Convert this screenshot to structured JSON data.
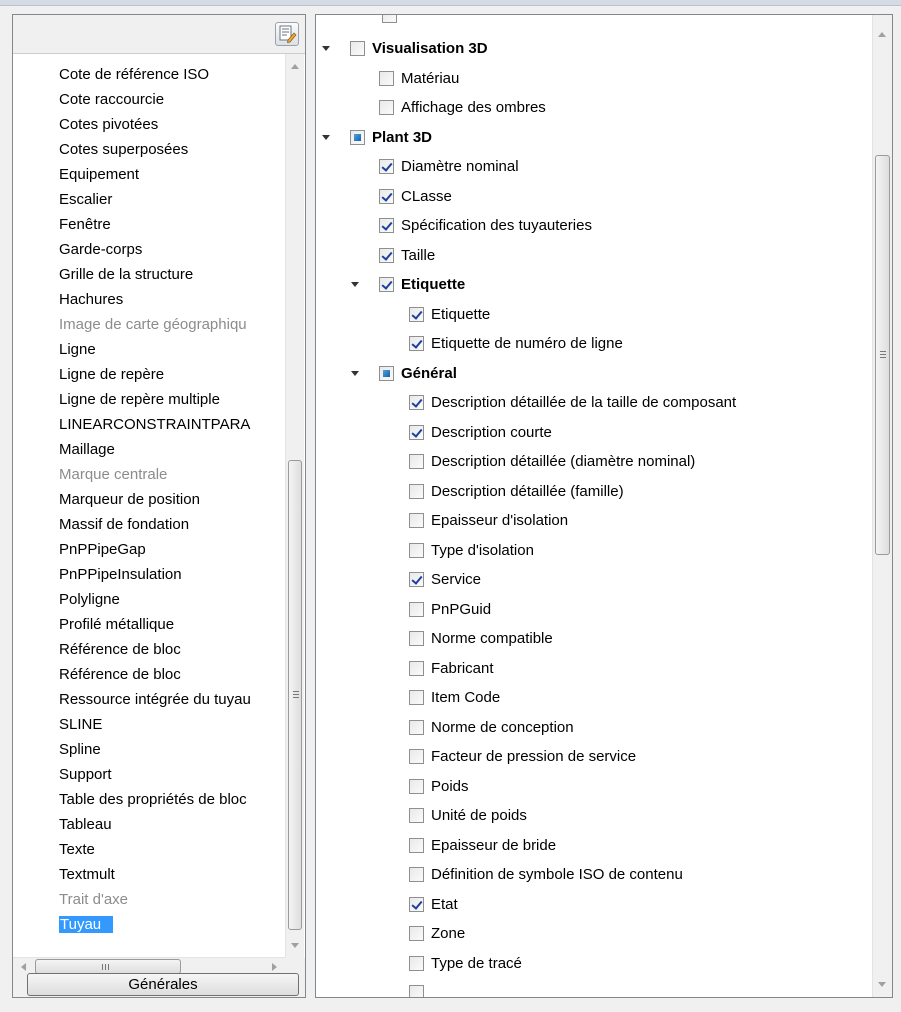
{
  "left_panel": {
    "toolbar_icon": "edit-list-icon",
    "items": [
      {
        "label": "Cote de référence ISO",
        "state": "normal"
      },
      {
        "label": "Cote raccourcie",
        "state": "normal"
      },
      {
        "label": "Cotes pivotées",
        "state": "normal"
      },
      {
        "label": "Cotes superposées",
        "state": "normal"
      },
      {
        "label": "Equipement",
        "state": "normal"
      },
      {
        "label": "Escalier",
        "state": "normal"
      },
      {
        "label": "Fenêtre",
        "state": "normal"
      },
      {
        "label": "Garde-corps",
        "state": "normal"
      },
      {
        "label": "Grille de la structure",
        "state": "normal"
      },
      {
        "label": "Hachures",
        "state": "normal"
      },
      {
        "label": "Image de carte géographiqu",
        "state": "disabled"
      },
      {
        "label": "Ligne",
        "state": "normal"
      },
      {
        "label": "Ligne de repère",
        "state": "normal"
      },
      {
        "label": "Ligne de repère multiple",
        "state": "normal"
      },
      {
        "label": "LINEARCONSTRAINTPARA",
        "state": "normal"
      },
      {
        "label": "Maillage",
        "state": "normal"
      },
      {
        "label": "Marque centrale",
        "state": "disabled"
      },
      {
        "label": "Marqueur de position",
        "state": "normal"
      },
      {
        "label": "Massif de fondation",
        "state": "normal"
      },
      {
        "label": "PnPPipeGap",
        "state": "normal"
      },
      {
        "label": "PnPPipeInsulation",
        "state": "normal"
      },
      {
        "label": "Polyligne",
        "state": "normal"
      },
      {
        "label": "Profilé métallique",
        "state": "normal"
      },
      {
        "label": "Référence de bloc",
        "state": "normal"
      },
      {
        "label": "Référence de bloc",
        "state": "normal"
      },
      {
        "label": "Ressource intégrée du tuyau",
        "state": "normal"
      },
      {
        "label": "SLINE",
        "state": "normal"
      },
      {
        "label": "Spline",
        "state": "normal"
      },
      {
        "label": "Support",
        "state": "normal"
      },
      {
        "label": "Table des propriétés de bloc",
        "state": "normal"
      },
      {
        "label": "Tableau",
        "state": "normal"
      },
      {
        "label": "Texte",
        "state": "normal"
      },
      {
        "label": "Textmult",
        "state": "normal"
      },
      {
        "label": "Trait d'axe",
        "state": "disabled"
      },
      {
        "label": "Tuyau",
        "state": "selected"
      }
    ],
    "hscroll_grip": "III",
    "button_label": "Générales"
  },
  "right_panel": {
    "tree": [
      {
        "label": "Visualisation 3D",
        "level": 0,
        "checked": "unchecked",
        "bold": true,
        "expander": true
      },
      {
        "label": "Matériau",
        "level": 1,
        "checked": "unchecked",
        "bold": false,
        "expander": false
      },
      {
        "label": "Affichage des ombres",
        "level": 1,
        "checked": "unchecked",
        "bold": false,
        "expander": false
      },
      {
        "label": "Plant 3D",
        "level": 0,
        "checked": "partial",
        "bold": true,
        "expander": true
      },
      {
        "label": "Diamètre nominal",
        "level": 1,
        "checked": "checked",
        "bold": false,
        "expander": false
      },
      {
        "label": "CLasse",
        "level": 1,
        "checked": "checked",
        "bold": false,
        "expander": false
      },
      {
        "label": "Spécification des tuyauteries",
        "level": 1,
        "checked": "checked",
        "bold": false,
        "expander": false
      },
      {
        "label": "Taille",
        "level": 1,
        "checked": "checked",
        "bold": false,
        "expander": false
      },
      {
        "label": "Etiquette",
        "level": 1,
        "checked": "checked",
        "bold": true,
        "expander": true
      },
      {
        "label": "Etiquette",
        "level": 2,
        "checked": "checked",
        "bold": false,
        "expander": false
      },
      {
        "label": "Etiquette de numéro de ligne",
        "level": 2,
        "checked": "checked",
        "bold": false,
        "expander": false
      },
      {
        "label": "Général",
        "level": 1,
        "checked": "partial",
        "bold": true,
        "expander": true
      },
      {
        "label": "Description détaillée de la taille de composant",
        "level": 2,
        "checked": "checked",
        "bold": false,
        "expander": false
      },
      {
        "label": "Description courte",
        "level": 2,
        "checked": "checked",
        "bold": false,
        "expander": false
      },
      {
        "label": "Description détaillée (diamètre nominal)",
        "level": 2,
        "checked": "unchecked",
        "bold": false,
        "expander": false
      },
      {
        "label": "Description détaillée (famille)",
        "level": 2,
        "checked": "unchecked",
        "bold": false,
        "expander": false
      },
      {
        "label": "Epaisseur d'isolation",
        "level": 2,
        "checked": "unchecked",
        "bold": false,
        "expander": false
      },
      {
        "label": "Type d'isolation",
        "level": 2,
        "checked": "unchecked",
        "bold": false,
        "expander": false
      },
      {
        "label": "Service",
        "level": 2,
        "checked": "checked",
        "bold": false,
        "expander": false
      },
      {
        "label": "PnPGuid",
        "level": 2,
        "checked": "unchecked",
        "bold": false,
        "expander": false
      },
      {
        "label": "Norme compatible",
        "level": 2,
        "checked": "unchecked",
        "bold": false,
        "expander": false
      },
      {
        "label": "Fabricant",
        "level": 2,
        "checked": "unchecked",
        "bold": false,
        "expander": false
      },
      {
        "label": "Item Code",
        "level": 2,
        "checked": "unchecked",
        "bold": false,
        "expander": false
      },
      {
        "label": "Norme de conception",
        "level": 2,
        "checked": "unchecked",
        "bold": false,
        "expander": false
      },
      {
        "label": "Facteur de pression de service",
        "level": 2,
        "checked": "unchecked",
        "bold": false,
        "expander": false
      },
      {
        "label": "Poids",
        "level": 2,
        "checked": "unchecked",
        "bold": false,
        "expander": false
      },
      {
        "label": "Unité de poids",
        "level": 2,
        "checked": "unchecked",
        "bold": false,
        "expander": false
      },
      {
        "label": "Epaisseur de bride",
        "level": 2,
        "checked": "unchecked",
        "bold": false,
        "expander": false
      },
      {
        "label": "Définition de symbole ISO de contenu",
        "level": 2,
        "checked": "unchecked",
        "bold": false,
        "expander": false
      },
      {
        "label": "Etat",
        "level": 2,
        "checked": "checked",
        "bold": false,
        "expander": false
      },
      {
        "label": "Zone",
        "level": 2,
        "checked": "unchecked",
        "bold": false,
        "expander": false
      },
      {
        "label": "Type de tracé",
        "level": 2,
        "checked": "unchecked",
        "bold": false,
        "expander": false
      }
    ]
  },
  "colors": {
    "selection": "#3399ff",
    "check": "#1e3f9e",
    "partial_fill": "#1a5fa8",
    "disabled_text": "#8c8c8c"
  }
}
